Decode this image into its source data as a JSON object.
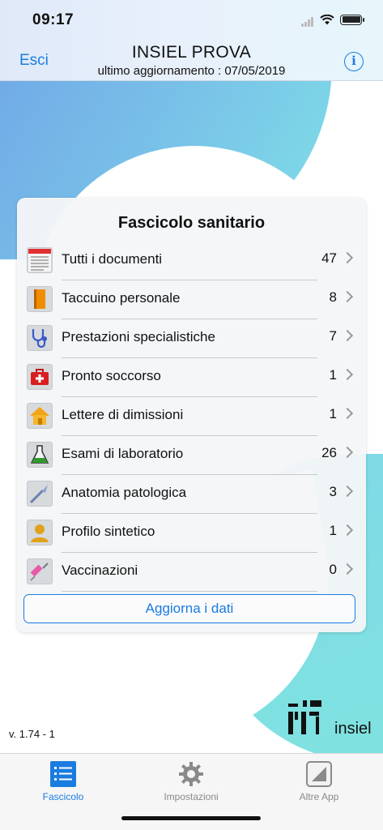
{
  "status_bar": {
    "time": "09:17"
  },
  "header": {
    "left_button": "Esci",
    "title": "INSIEL PROVA",
    "subtitle": "ultimo aggiornamento : 07/05/2019",
    "info_icon": "info-icon"
  },
  "card": {
    "title": "Fascicolo sanitario",
    "items": [
      {
        "label": "Tutti i documenti",
        "count": "47",
        "icon": "documents-icon"
      },
      {
        "label": "Taccuino personale",
        "count": "8",
        "icon": "notebook-icon"
      },
      {
        "label": "Prestazioni specialistiche",
        "count": "7",
        "icon": "stethoscope-icon"
      },
      {
        "label": "Pronto soccorso",
        "count": "1",
        "icon": "first-aid-icon"
      },
      {
        "label": "Lettere di dimissioni",
        "count": "1",
        "icon": "house-icon"
      },
      {
        "label": "Esami di laboratorio",
        "count": "26",
        "icon": "flask-icon"
      },
      {
        "label": "Anatomia patologica",
        "count": "3",
        "icon": "scalpel-icon"
      },
      {
        "label": "Profilo sintetico",
        "count": "1",
        "icon": "person-icon"
      },
      {
        "label": "Vaccinazioni",
        "count": "0",
        "icon": "syringe-icon"
      }
    ],
    "refresh_button": "Aggiorna i dati"
  },
  "version": "v. 1.74 - 1",
  "logo": {
    "text": "insiel"
  },
  "tabbar": {
    "tabs": [
      {
        "label": "Fascicolo",
        "icon": "list-icon",
        "active": true
      },
      {
        "label": "Impostazioni",
        "icon": "gear-icon",
        "active": false
      },
      {
        "label": "Altre App",
        "icon": "apps-icon",
        "active": false
      }
    ]
  },
  "colors": {
    "accent": "#1a7ce0",
    "teal": "#7fe0e6"
  }
}
